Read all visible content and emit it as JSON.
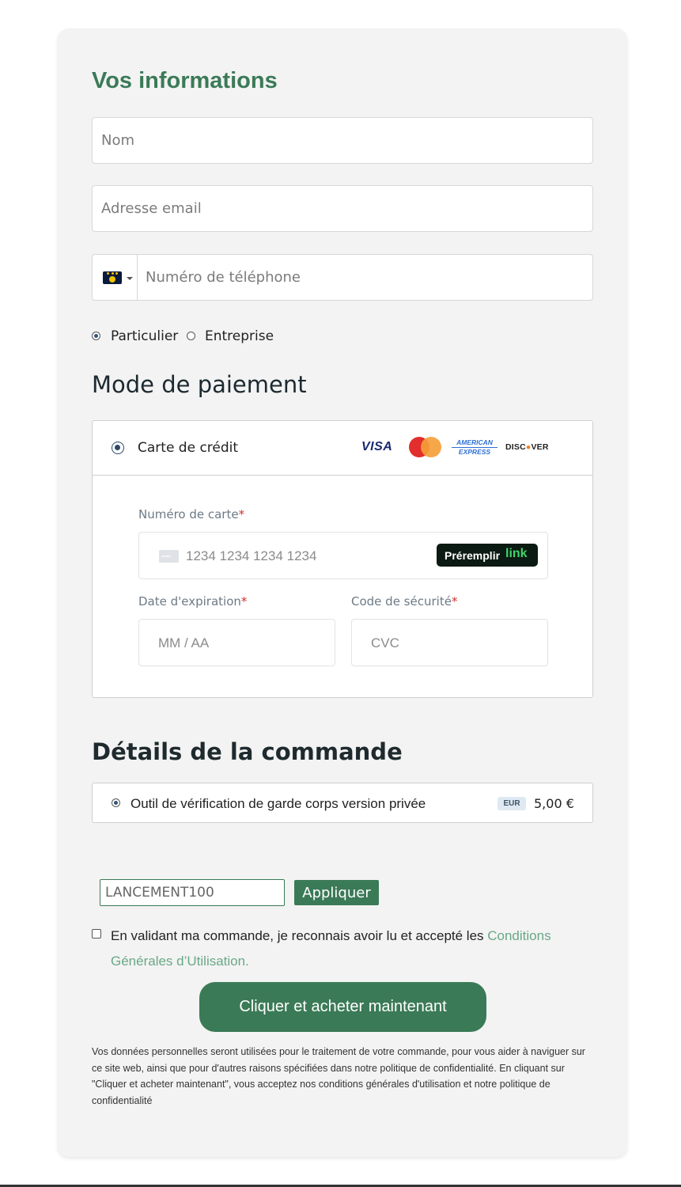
{
  "info": {
    "heading": "Vos informations",
    "name_placeholder": "Nom",
    "email_placeholder": "Adresse email",
    "phone_placeholder": "Numéro de téléphone",
    "customer_types": [
      {
        "label": "Particulier",
        "selected": true
      },
      {
        "label": "Entreprise",
        "selected": false
      }
    ]
  },
  "payment": {
    "heading": "Mode de paiement",
    "method_label": "Carte de crédit",
    "brands": {
      "visa": "VISA",
      "amex_line1": "AMERICAN",
      "amex_line2": "EXPRESS",
      "discover": "DISCOVER"
    },
    "card_number_label": "Numéro de carte",
    "card_number_placeholder": "1234 1234 1234 1234",
    "prefill_label": "Préremplir",
    "prefill_brand": "link",
    "expiry_label": "Date d'expiration",
    "expiry_placeholder": "MM / AA",
    "cvc_label": "Code de sécurité",
    "cvc_placeholder": "CVC",
    "required_mark": "*"
  },
  "order": {
    "heading": "Détails de la commande",
    "item_label": "Outil de vérification de garde corps version privée",
    "currency_badge": "EUR",
    "price": "5,00 €"
  },
  "coupon": {
    "value": "LANCEMENT100",
    "apply_label": "Appliquer"
  },
  "terms": {
    "text": "En validant ma commande, je reconnais avoir lu et accepté les ",
    "link_text": "Conditions Générales d’Utilisation."
  },
  "buy_button_label": "Cliquer et acheter maintenant",
  "privacy_text": "Vos données personnelles seront utilisées pour le traitement de votre commande, pour vous aider à naviguer sur ce site web, ainsi que pour d'autres raisons spécifiées dans notre politique de confidentialité. En cliquant sur \"Cliquer et acheter maintenant\", vous acceptez nos conditions générales d'utilisation et notre politique de confidentialité",
  "colors": {
    "accent": "#3b7a57",
    "link": "#6aa886",
    "card_bg": "#f3f3f3"
  }
}
